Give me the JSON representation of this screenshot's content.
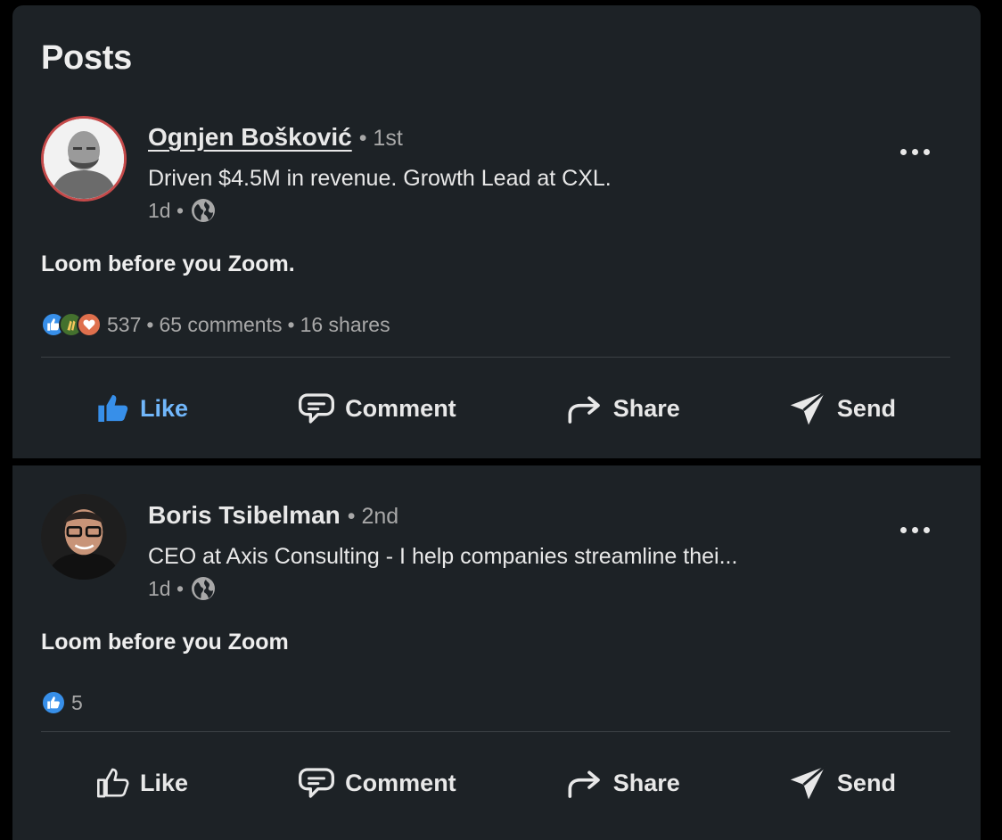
{
  "section_title": "Posts",
  "colors": {
    "card_bg": "#1d2226",
    "page_bg": "#000000",
    "text_primary": "#e8e8e8",
    "text_secondary": "#a8a8a8",
    "like_active": "#71b7fb",
    "divider": "#3c4145"
  },
  "posts": [
    {
      "author_name": "Ognjen Bošković",
      "degree": "• 1st",
      "headline": "Driven $4.5M in revenue. Growth Lead at CXL.",
      "time": "1d •",
      "visibility_icon": "globe-icon",
      "text": "Loom before you Zoom.",
      "reactions": [
        "like-icon",
        "celebrate-icon",
        "love-icon"
      ],
      "reaction_count": "537",
      "stats_sep": "•",
      "comments": "65 comments",
      "stats_sep2": "•",
      "shares": "16 shares",
      "actions": {
        "like": "Like",
        "comment": "Comment",
        "share": "Share",
        "send": "Send"
      },
      "liked": true
    },
    {
      "author_name": "Boris Tsibelman",
      "degree": "• 2nd",
      "headline": "CEO at Axis Consulting - I help companies streamline thei...",
      "time": "1d •",
      "visibility_icon": "globe-icon",
      "text": "Loom before you Zoom",
      "reactions": [
        "like-icon"
      ],
      "reaction_count": "5",
      "actions": {
        "like": "Like",
        "comment": "Comment",
        "share": "Share",
        "send": "Send"
      },
      "liked": false
    }
  ]
}
